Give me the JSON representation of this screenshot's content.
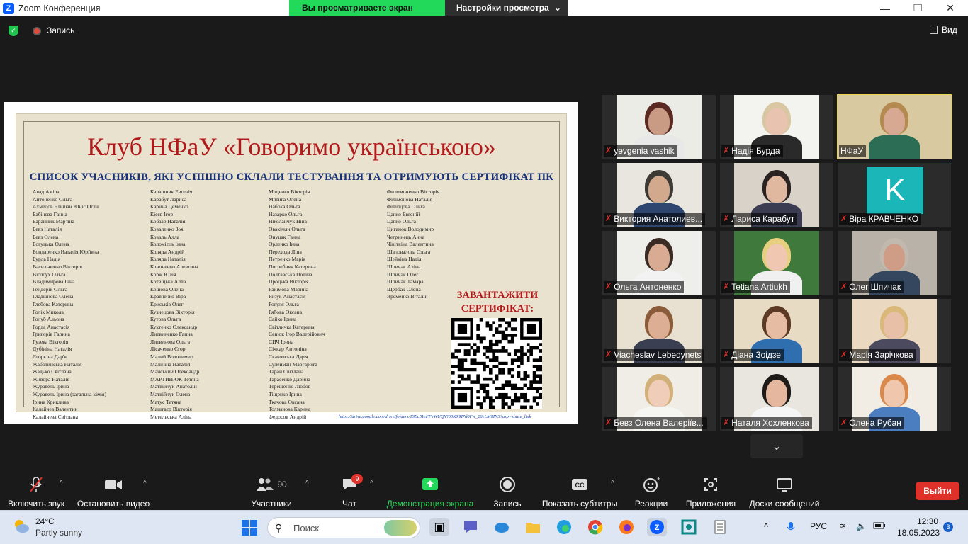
{
  "window": {
    "title": "Zoom Конференция",
    "sharing_banner": "Вы просматриваете экран НФаУ",
    "view_options": "Настройки просмотра"
  },
  "topbar": {
    "record_label": "Запись",
    "view_label": "Вид"
  },
  "slide": {
    "title": "Клуб НФаУ «Говоримо українською»",
    "subtitle": "СПИСОК УЧАСНИКІВ, ЯКІ УСПІШНО СКЛАЛИ ТЕСТУВАННЯ ТА ОТРИМУЮТЬ СЕРТИФІКАТ ПК",
    "columns": [
      [
        "Авад Аміра",
        "Антоненко Ольга",
        "Ахмедов Ельшан Юніс Огли",
        "Бабічева Ганна",
        "Баранник Мар'яна",
        "Бевз Наталія",
        "Бевз Олена",
        "Богуцька Олена",
        "Бондаренко Наталія Юріївна",
        "Бурда Надія",
        "Васильченко Вікторія",
        "Віслоух Ольга",
        "Владимирова Інна",
        "Гейдерік Ольга",
        "Гладшнова Олена",
        "Глебова Катерина",
        "Голік Микола",
        "Голуб Альона",
        "Горда Анастасія",
        "Григорів Галина",
        "Гузева Вікторія",
        "Дубініна Наталія",
        "Єгоркіна Дар'я",
        "Жаботинська Наталія",
        "Жадько Світлана",
        "Живора Наталія",
        "Журавель Ірина",
        "Журавель Ірина (загальна хімія)",
        "Ірина Криклива",
        "Калайчев Валентин",
        "Калайчева Світлана"
      ],
      [
        "Калашник Евгенія",
        "Карабут Лариса",
        "Карина Цеменко",
        "Кієєв Ігор",
        "Кобзар Наталія",
        "Коваленко Зоя",
        "Коваль Алла",
        "Коломієць Інна",
        "Коляда Андрій",
        "Коляда Наталія",
        "Кононенко Алевтина",
        "Корж Юлія",
        "Котвіцька Алла",
        "Кошова Олена",
        "Кравченко Віра",
        "Криськів Олег",
        "Кузнецова Вікторія",
        "Кутова Ольга",
        "Кухтенко Олександр",
        "Литвиненко Ганна",
        "Литвинова Ольга",
        "Лісаченко Єгор",
        "Малий Володимир",
        "Малініна Наталія",
        "Манський Олександр",
        "МАРТИНЮК Тетяна",
        "Матвійчук Анатолій",
        "Матвійчук Олена",
        "Матус Тетяна",
        "Маштаєр Вікторія",
        "Метельська Аліна"
      ],
      [
        "Міщенко Вікторія",
        "Мятига Олена",
        "Набока Ольга",
        "Назарко Ольга",
        "Ніколайчук Ніна",
        "Овакімян Ольга",
        "Онуцак Ганна",
        "Орленко Інна",
        "Перехода Ліна",
        "Петренко Марія",
        "Погребняк Катерина",
        "Полтавська Поліна",
        "Процька Вікторія",
        "Ракімова Марина",
        "Ризук Анастасія",
        "Рогуля Ольга",
        "Рябова Оксана",
        "Сайко Ірина",
        "Світличка Катерина",
        "Сенюк Ігор Валерійович",
        "СИЧ Ірина",
        "Січкар Антоніна",
        "Скаковська Дар'я",
        "Сулейман Маргарита",
        "Таран Світлана",
        "Тарасенко Дарина",
        "Терещенко Любов",
        "Тіщенко Ірина",
        "Ткачова Оксана",
        "Толмачова Карина",
        "Федосов Андрій"
      ],
      [
        "Филимоненко Вікторія",
        "Філімонова Наталія",
        "Філіпцова Ольга",
        "Цапко Евгеній",
        "Цапко Ольга",
        "Циганок Володимир",
        "Чегринець Анна",
        "Чікіткіна Валентина",
        "Шаповалова Ольга",
        "Шейкіна Надія",
        "Шпичак Аліна",
        "Шпичак Олег",
        "Шпичак Тамара",
        "Щербак Олена",
        "Яременко Віталій"
      ]
    ],
    "download_title_line1": "ЗАВАНТАЖИТИ",
    "download_title_line2": "СЕРТИФІКАТ:",
    "link": "https://drive.google.com/drive/folders/1SEc5YeFFvWUQV!60KXM7d0Fw_26yLMMN3?usp=share_link"
  },
  "participants": [
    {
      "name": "yevgenia vashik",
      "muted": true
    },
    {
      "name": "Надія Бурда",
      "muted": true
    },
    {
      "name": "НФаУ",
      "muted": false,
      "active": true
    },
    {
      "name": "Виктория Анатолиев...",
      "muted": true
    },
    {
      "name": "Лариса Карабут",
      "muted": true
    },
    {
      "name": "Віра КРАВЧЕНКО",
      "muted": true,
      "avatar_letter": "K"
    },
    {
      "name": "Ольга Антоненко",
      "muted": true
    },
    {
      "name": "Tetiana Artiukh",
      "muted": true
    },
    {
      "name": "Олег Шпичак",
      "muted": true
    },
    {
      "name": "Viacheslav Lebedynets",
      "muted": true
    },
    {
      "name": "Діана Зоідзе",
      "muted": true
    },
    {
      "name": "Марія Зарічкова",
      "muted": true
    },
    {
      "name": "Бевз Олена Валеріїв...",
      "muted": true
    },
    {
      "name": "Наталя Хохленкова",
      "muted": true
    },
    {
      "name": "Олена Рубан",
      "muted": true
    }
  ],
  "toolbar": {
    "unmute": "Включить звук",
    "start_video": "Остановить видео",
    "participants": "Участники",
    "participants_count": "90",
    "chat": "Чат",
    "chat_badge": "9",
    "share": "Демонстрация экрана",
    "record": "Запись",
    "captions": "Показать субтитры",
    "reactions": "Реакции",
    "apps": "Приложения",
    "whiteboards": "Доски сообщений",
    "leave": "Выйти",
    "cc_icon_text": "CC"
  },
  "taskbar": {
    "temperature": "24°C",
    "weather": "Partly sunny",
    "search_placeholder": "Поиск",
    "language": "РУС",
    "time": "12:30",
    "date": "18.05.2023",
    "notifications": "3"
  },
  "colors": {
    "share_green": "#23d959",
    "leave_red": "#e0302a",
    "slide_title_red": "#b01a1a",
    "slide_subtitle_blue": "#16337a"
  }
}
